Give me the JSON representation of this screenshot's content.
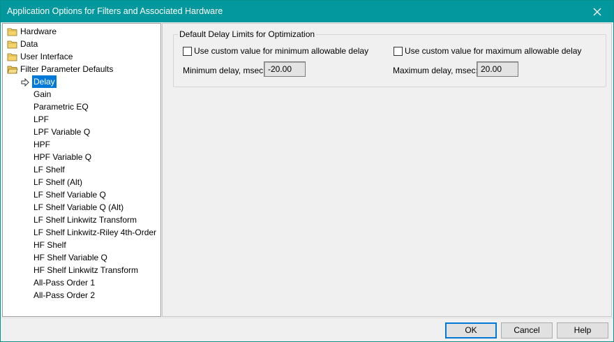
{
  "window": {
    "title": "Application Options for Filters and Associated Hardware"
  },
  "tree": {
    "top_items": [
      {
        "label": "Hardware",
        "icon": "folder-icon"
      },
      {
        "label": "Data",
        "icon": "folder-icon"
      },
      {
        "label": "User Interface",
        "icon": "folder-icon"
      },
      {
        "label": "Filter Parameter Defaults",
        "icon": "folder-open-icon"
      }
    ],
    "children": [
      "Delay",
      "Gain",
      "Parametric EQ",
      "LPF",
      "LPF Variable Q",
      "HPF",
      "HPF Variable Q",
      "LF Shelf",
      "LF Shelf (Alt)",
      "LF Shelf Variable Q",
      "LF Shelf Variable Q (Alt)",
      "LF Shelf Linkwitz Transform",
      "LF Shelf Linkwitz-Riley 4th-Order",
      "HF Shelf",
      "HF Shelf Variable Q",
      "HF Shelf Linkwitz Transform",
      "All-Pass Order 1",
      "All-Pass Order 2"
    ],
    "selected": "Delay"
  },
  "delay_limits": {
    "group_title": "Default Delay Limits for Optimization",
    "min_checkbox_label": "Use custom value for minimum allowable delay",
    "max_checkbox_label": "Use custom value for maximum allowable delay",
    "min_checked": false,
    "max_checked": false,
    "min_label": "Minimum delay, msec:",
    "min_value": "-20.00",
    "max_label": "Maximum delay, msec:",
    "max_value": "20.00"
  },
  "buttons": {
    "ok": "OK",
    "cancel": "Cancel",
    "help": "Help"
  },
  "colors": {
    "titlebar": "#03989e",
    "selection": "#0078d7",
    "folder": "#f5d36b"
  }
}
